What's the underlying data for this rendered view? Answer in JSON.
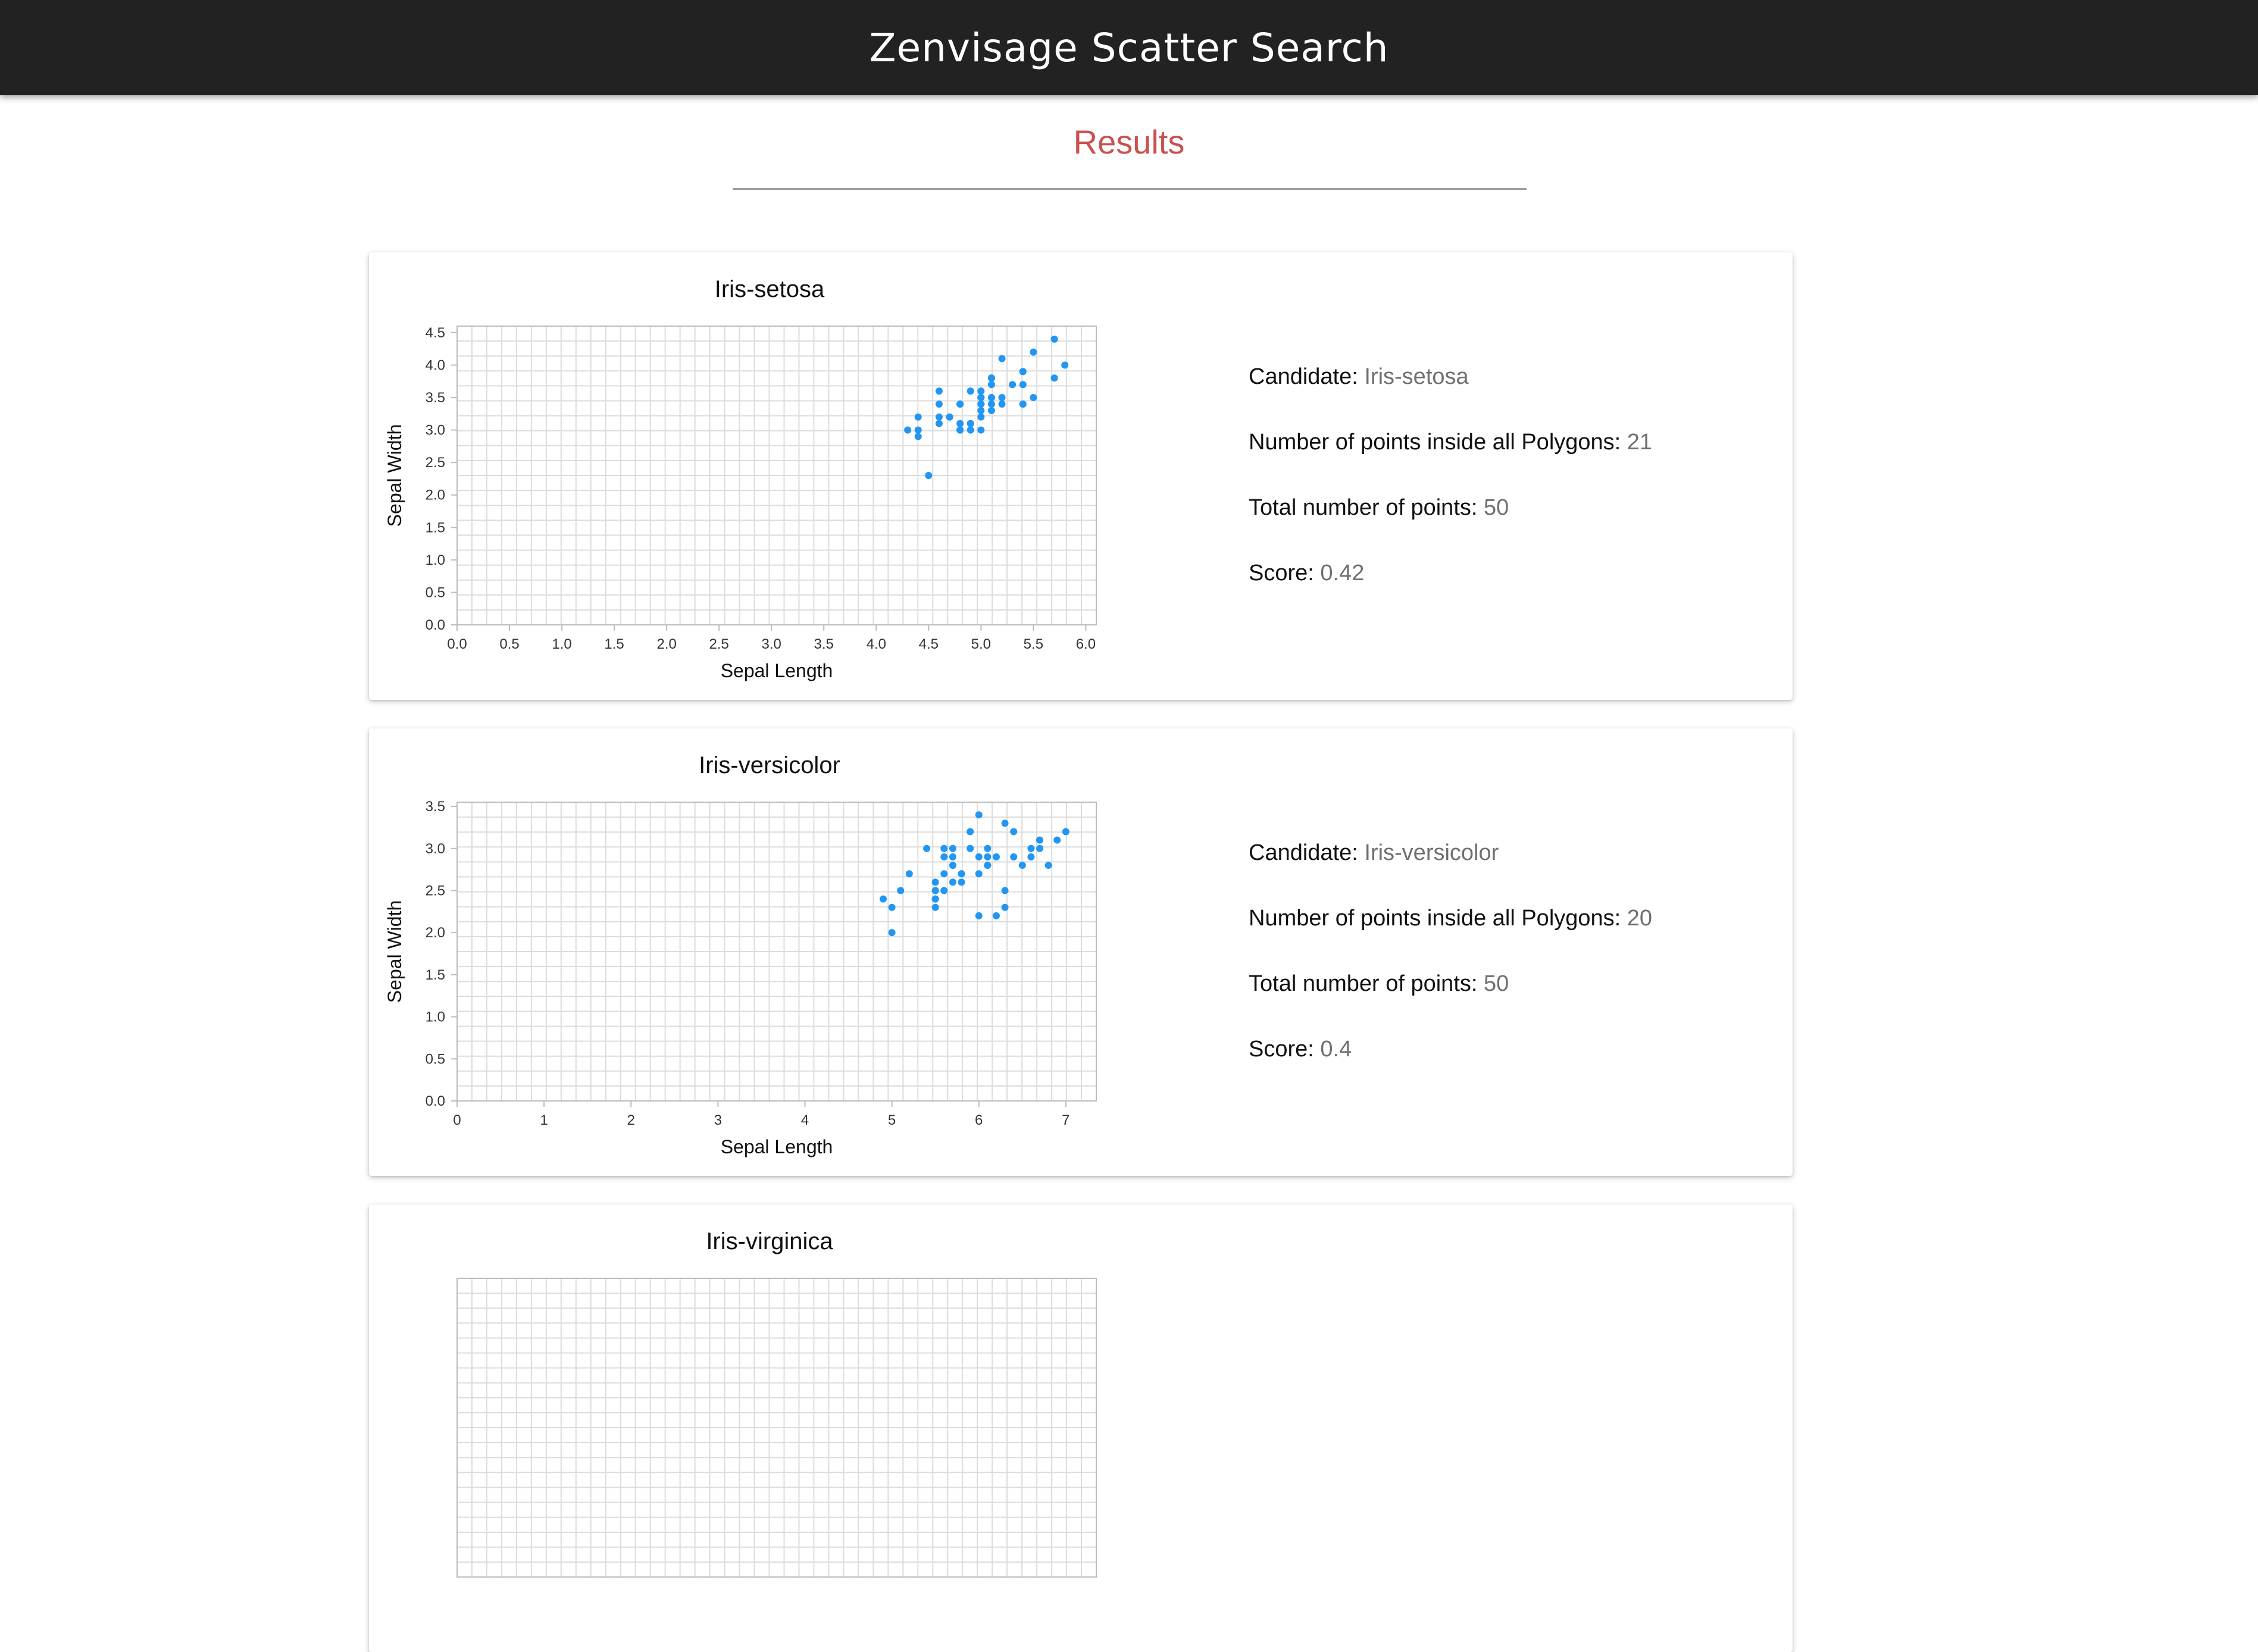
{
  "header": {
    "title": "Zenvisage Scatter Search"
  },
  "results": {
    "title": "Results"
  },
  "labels": {
    "candidate": "Candidate:",
    "inside": "Number of points inside all Polygons:",
    "total": "Total number of points:",
    "score": "Score:"
  },
  "colors": {
    "header_bg": "#222222",
    "results_title": "#c9524f",
    "point": "#2196f3"
  },
  "cards": [
    {
      "title": "Iris-setosa",
      "candidate": "Iris-setosa",
      "inside_count": "21",
      "total_points": "50",
      "score": "0.42"
    },
    {
      "title": "Iris-versicolor",
      "candidate": "Iris-versicolor",
      "inside_count": "20",
      "total_points": "50",
      "score": "0.4"
    },
    {
      "title": "Iris-virginica"
    }
  ],
  "chart_data": [
    {
      "type": "scatter",
      "title": "Iris-setosa",
      "xlabel": "Sepal Length",
      "ylabel": "Sepal Width",
      "xlim": [
        0,
        6.1
      ],
      "ylim": [
        0,
        4.6
      ],
      "xticks": [
        "0.0",
        "0.5",
        "1.0",
        "1.5",
        "2.0",
        "2.5",
        "3.0",
        "3.5",
        "4.0",
        "4.5",
        "5.0",
        "5.5",
        "6.0"
      ],
      "yticks": [
        "0.0",
        "0.5",
        "1.0",
        "1.5",
        "2.0",
        "2.5",
        "3.0",
        "3.5",
        "4.0",
        "4.5"
      ],
      "grid": true,
      "points": [
        [
          5.1,
          3.5
        ],
        [
          4.9,
          3.0
        ],
        [
          4.7,
          3.2
        ],
        [
          4.6,
          3.1
        ],
        [
          5.0,
          3.6
        ],
        [
          5.4,
          3.9
        ],
        [
          4.6,
          3.4
        ],
        [
          5.0,
          3.4
        ],
        [
          4.4,
          2.9
        ],
        [
          4.9,
          3.1
        ],
        [
          5.4,
          3.7
        ],
        [
          4.8,
          3.4
        ],
        [
          4.8,
          3.0
        ],
        [
          4.3,
          3.0
        ],
        [
          5.8,
          4.0
        ],
        [
          5.7,
          4.4
        ],
        [
          5.4,
          3.9
        ],
        [
          5.1,
          3.5
        ],
        [
          5.7,
          3.8
        ],
        [
          5.1,
          3.8
        ],
        [
          5.4,
          3.4
        ],
        [
          5.1,
          3.7
        ],
        [
          4.6,
          3.6
        ],
        [
          5.1,
          3.3
        ],
        [
          4.8,
          3.4
        ],
        [
          5.0,
          3.0
        ],
        [
          5.0,
          3.4
        ],
        [
          5.2,
          3.5
        ],
        [
          5.2,
          3.4
        ],
        [
          4.7,
          3.2
        ],
        [
          4.8,
          3.1
        ],
        [
          5.4,
          3.4
        ],
        [
          5.2,
          4.1
        ],
        [
          5.5,
          4.2
        ],
        [
          4.9,
          3.1
        ],
        [
          5.0,
          3.2
        ],
        [
          5.5,
          3.5
        ],
        [
          4.9,
          3.6
        ],
        [
          4.4,
          3.0
        ],
        [
          5.1,
          3.4
        ],
        [
          5.0,
          3.5
        ],
        [
          4.5,
          2.3
        ],
        [
          4.4,
          3.2
        ],
        [
          5.0,
          3.5
        ],
        [
          5.1,
          3.8
        ],
        [
          4.8,
          3.0
        ],
        [
          5.1,
          3.8
        ],
        [
          4.6,
          3.2
        ],
        [
          5.3,
          3.7
        ],
        [
          5.0,
          3.3
        ]
      ]
    },
    {
      "type": "scatter",
      "title": "Iris-versicolor",
      "xlabel": "Sepal Length",
      "ylabel": "Sepal Width",
      "xlim": [
        0,
        7.35
      ],
      "ylim": [
        0,
        3.55
      ],
      "xticks": [
        "0",
        "1",
        "2",
        "3",
        "4",
        "5",
        "6",
        "7"
      ],
      "yticks": [
        "0.0",
        "0.5",
        "1.0",
        "1.5",
        "2.0",
        "2.5",
        "3.0",
        "3.5"
      ],
      "grid": true,
      "points": [
        [
          7.0,
          3.2
        ],
        [
          6.4,
          3.2
        ],
        [
          6.9,
          3.1
        ],
        [
          5.5,
          2.3
        ],
        [
          6.5,
          2.8
        ],
        [
          5.7,
          2.8
        ],
        [
          6.3,
          3.3
        ],
        [
          4.9,
          2.4
        ],
        [
          6.6,
          2.9
        ],
        [
          5.2,
          2.7
        ],
        [
          5.0,
          2.0
        ],
        [
          5.9,
          3.0
        ],
        [
          6.0,
          2.2
        ],
        [
          6.1,
          2.9
        ],
        [
          5.6,
          2.9
        ],
        [
          6.7,
          3.1
        ],
        [
          5.6,
          3.0
        ],
        [
          5.8,
          2.7
        ],
        [
          6.2,
          2.2
        ],
        [
          5.6,
          2.5
        ],
        [
          5.9,
          3.2
        ],
        [
          6.1,
          2.8
        ],
        [
          6.3,
          2.5
        ],
        [
          6.1,
          2.8
        ],
        [
          6.4,
          2.9
        ],
        [
          6.6,
          3.0
        ],
        [
          6.8,
          2.8
        ],
        [
          6.7,
          3.0
        ],
        [
          6.0,
          2.9
        ],
        [
          5.7,
          2.6
        ],
        [
          5.5,
          2.4
        ],
        [
          5.5,
          2.4
        ],
        [
          5.8,
          2.7
        ],
        [
          6.0,
          2.7
        ],
        [
          5.4,
          3.0
        ],
        [
          6.0,
          3.4
        ],
        [
          6.7,
          3.1
        ],
        [
          6.3,
          2.3
        ],
        [
          5.6,
          3.0
        ],
        [
          5.5,
          2.5
        ],
        [
          5.5,
          2.6
        ],
        [
          6.1,
          3.0
        ],
        [
          5.8,
          2.6
        ],
        [
          5.0,
          2.3
        ],
        [
          5.6,
          2.7
        ],
        [
          5.7,
          3.0
        ],
        [
          5.7,
          2.9
        ],
        [
          6.2,
          2.9
        ],
        [
          5.1,
          2.5
        ],
        [
          5.7,
          2.8
        ]
      ]
    },
    {
      "type": "scatter",
      "title": "Iris-virginica",
      "grid": true,
      "points": []
    }
  ]
}
